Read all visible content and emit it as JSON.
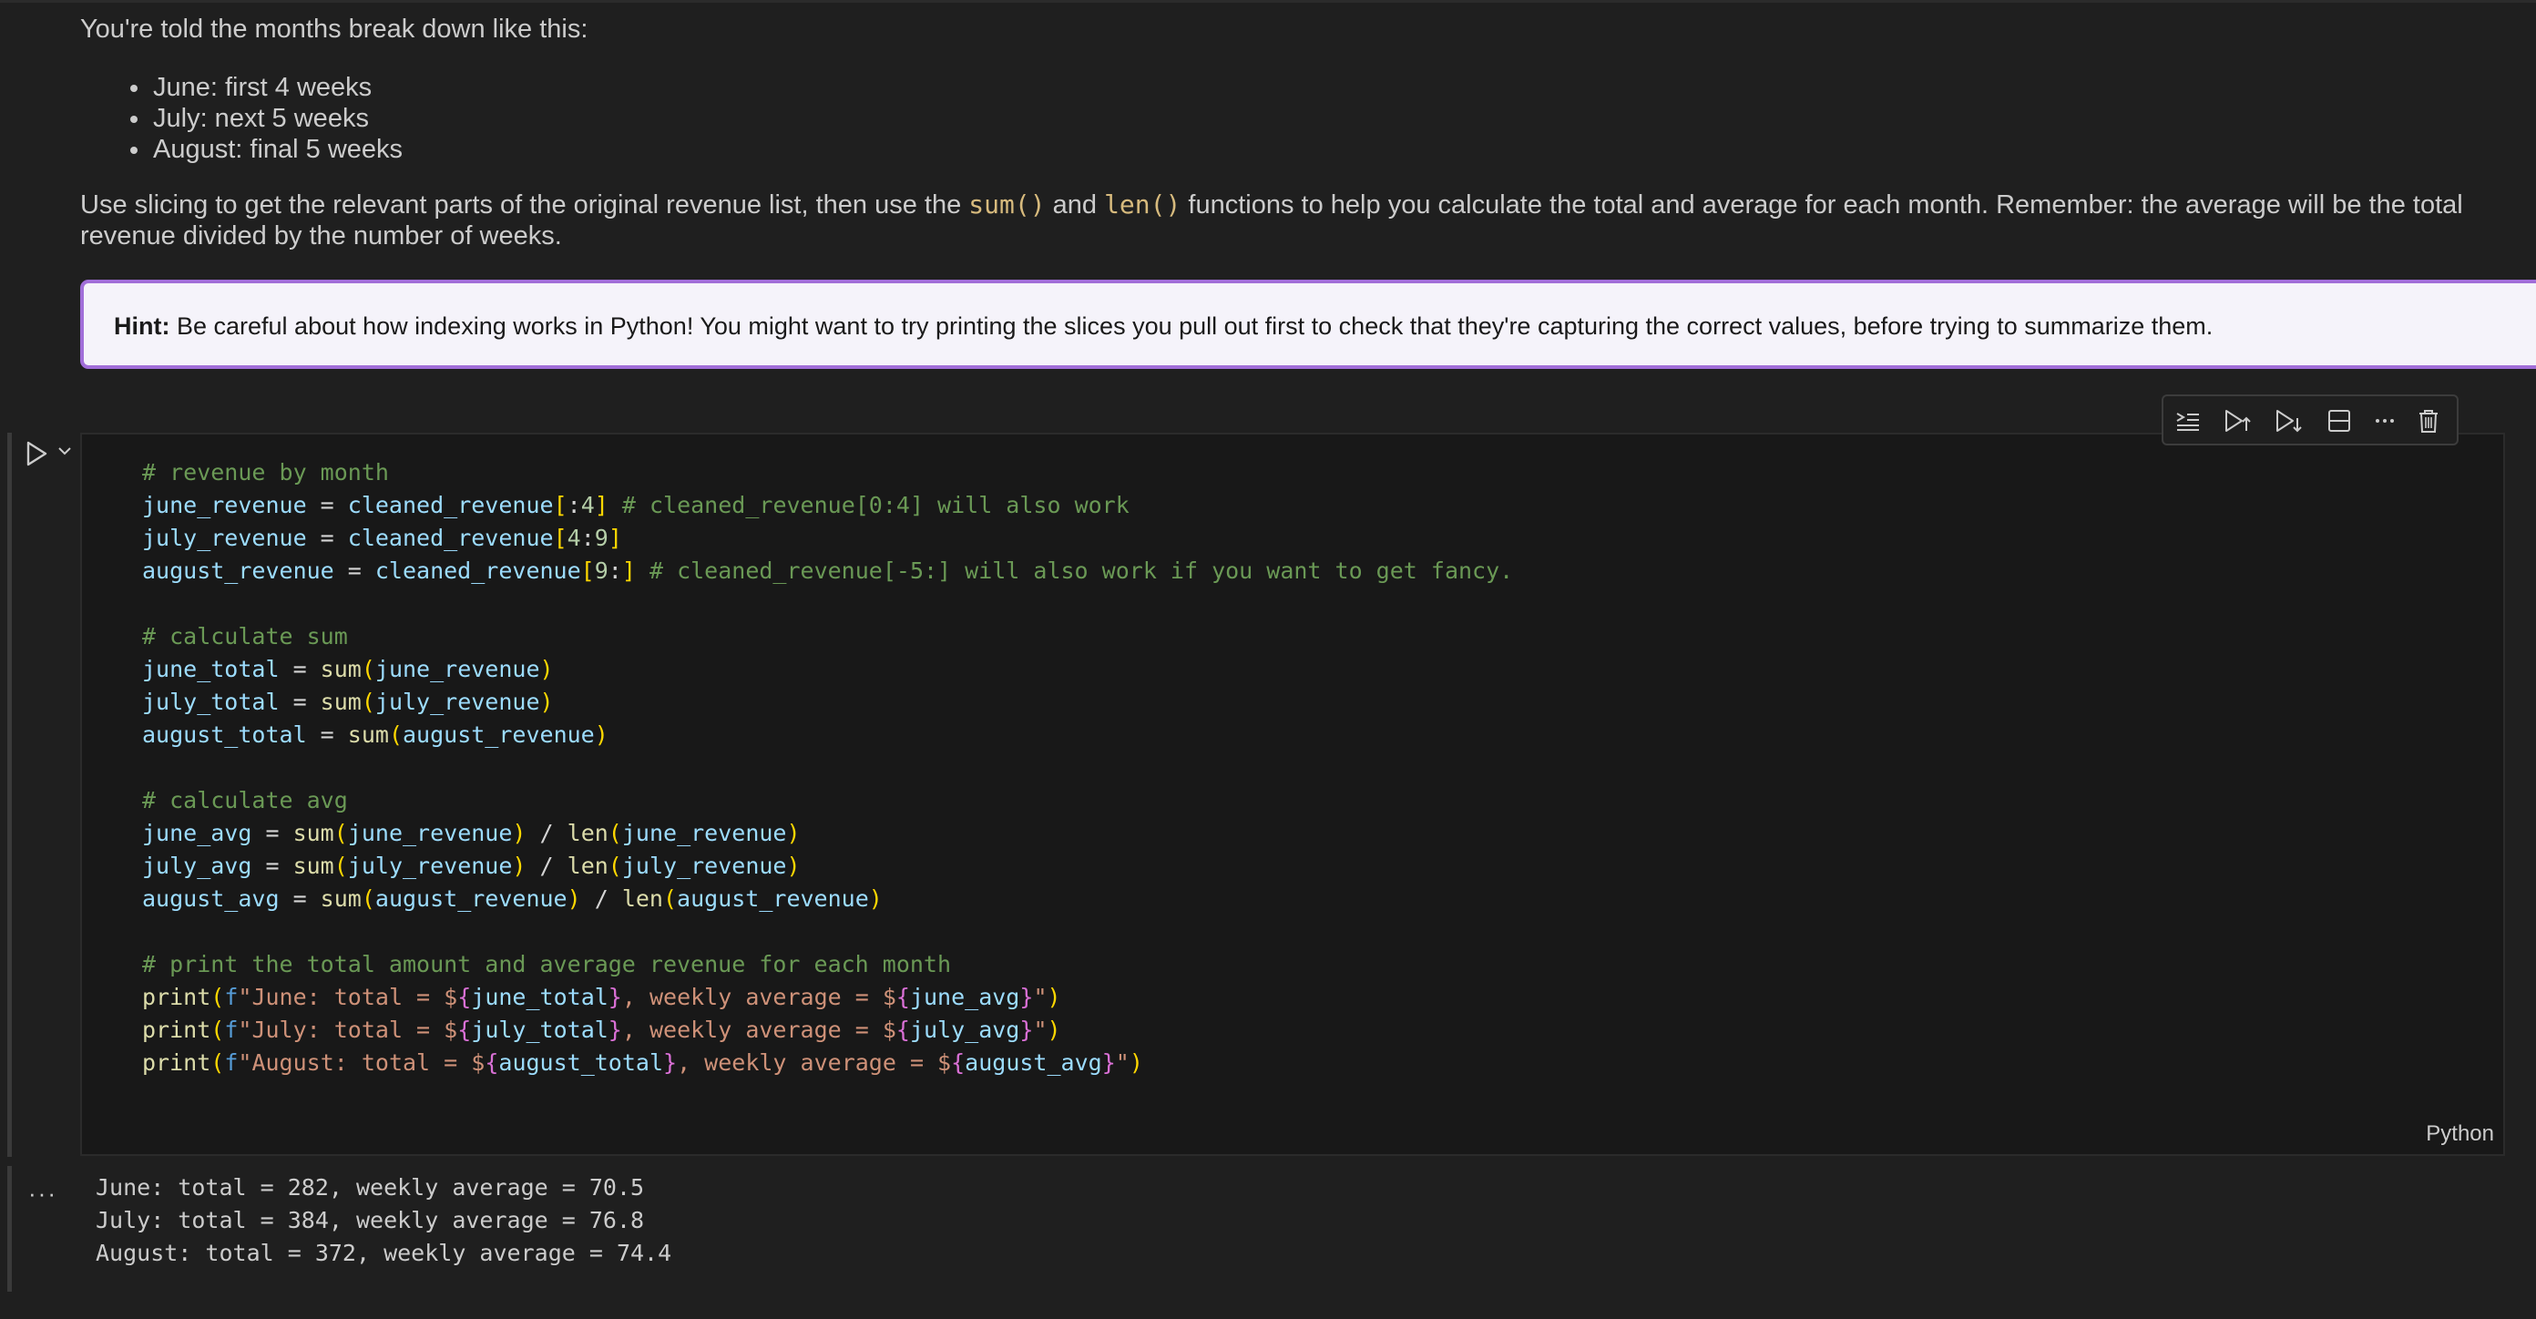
{
  "markdown": {
    "intro": "You're told the months break down like this:",
    "bullets": [
      "June: first 4 weeks",
      "July: next 5 weeks",
      "August: final 5 weeks"
    ],
    "para_part1": "Use slicing to get the relevant parts of the original revenue list, then use the ",
    "para_code1": "sum()",
    "para_part2": " and ",
    "para_code2": "len()",
    "para_part3": " functions to help you calculate the total and average for each month. Remember: the average will be the total revenue divided by the number of weeks.",
    "hint_label": "Hint:",
    "hint_text": " Be careful about how indexing works in Python! You might want to try printing the slices you pull out first to check that they're capturing the correct values, before trying to summarize them."
  },
  "cell": {
    "language": "Python",
    "code": [
      "# revenue by month",
      "june_revenue = cleaned_revenue[:4] # cleaned_revenue[0:4] will also work",
      "july_revenue = cleaned_revenue[4:9]",
      "august_revenue = cleaned_revenue[9:] # cleaned_revenue[-5:] will also work if you want to get fancy.",
      "",
      "# calculate sum",
      "june_total = sum(june_revenue)",
      "july_total = sum(july_revenue)",
      "august_total = sum(august_revenue)",
      "",
      "# calculate avg",
      "june_avg = sum(june_revenue) / len(june_revenue)",
      "july_avg = sum(july_revenue) / len(july_revenue)",
      "august_avg = sum(august_revenue) / len(august_revenue)",
      "",
      "# print the total amount and average revenue for each month",
      "print(f\"June: total = ${june_total}, weekly average = ${june_avg}\")",
      "print(f\"July: total = ${july_total}, weekly average = ${july_avg}\")",
      "print(f\"August: total = ${august_total}, weekly average = ${august_avg}\")"
    ],
    "toolbar": [
      "execute-above-icon",
      "run-above-icon",
      "run-below-icon",
      "split-cell-icon",
      "more-icon",
      "delete-icon"
    ]
  },
  "output": {
    "dots": "···",
    "lines": [
      "June: total = 282, weekly average = 70.5",
      "July: total = 384, weekly average = 76.8",
      "August: total = 372, weekly average = 74.4"
    ]
  }
}
